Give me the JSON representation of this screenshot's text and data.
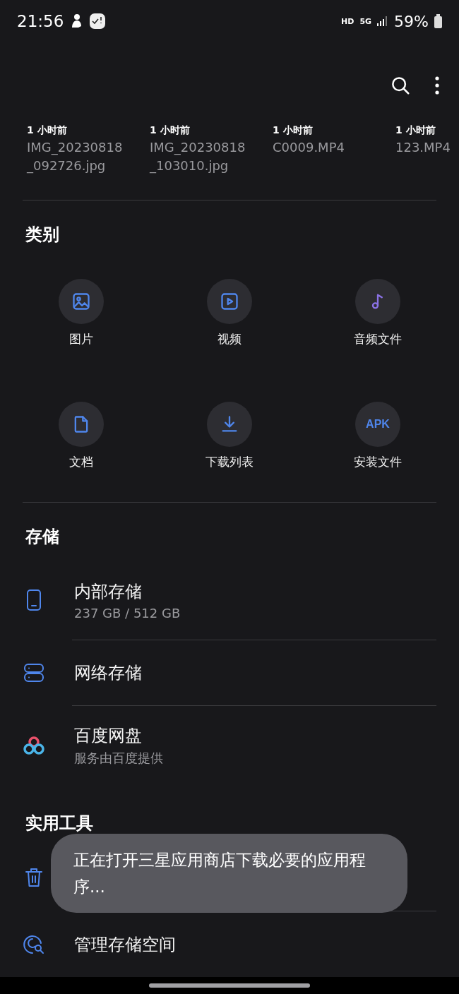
{
  "status_bar": {
    "time": "21:56",
    "hd": "HD",
    "network": "5G",
    "battery": "59%"
  },
  "recent_files": [
    {
      "time": "1 小时前",
      "name": "IMG_20230818\n_092726.jpg"
    },
    {
      "time": "1 小时前",
      "name": "IMG_20230818\n_103010.jpg"
    },
    {
      "time": "1 小时前",
      "name": "C0009.MP4"
    },
    {
      "time": "1 小时前",
      "name": "123.MP4"
    }
  ],
  "categories": {
    "title": "类别",
    "items": [
      {
        "kind": "image",
        "label": "图片"
      },
      {
        "kind": "video",
        "label": "视频"
      },
      {
        "kind": "audio",
        "label": "音频文件"
      },
      {
        "kind": "document",
        "label": "文档"
      },
      {
        "kind": "download",
        "label": "下载列表"
      },
      {
        "kind": "apk",
        "label": "安装文件",
        "badge": "APK"
      }
    ]
  },
  "storage": {
    "title": "存储",
    "items": [
      {
        "kind": "phone",
        "name": "内部存储",
        "detail": "237 GB / 512 GB"
      },
      {
        "kind": "network",
        "name": "网络存储"
      },
      {
        "kind": "baidu",
        "name": "百度网盘",
        "detail": "服务由百度提供"
      }
    ]
  },
  "tools": {
    "title": "实用工具",
    "items": [
      {
        "kind": "trash"
      },
      {
        "kind": "manage",
        "name": "管理存储空间"
      }
    ]
  },
  "toast": "正在打开三星应用商店下载必要的应用程序..."
}
